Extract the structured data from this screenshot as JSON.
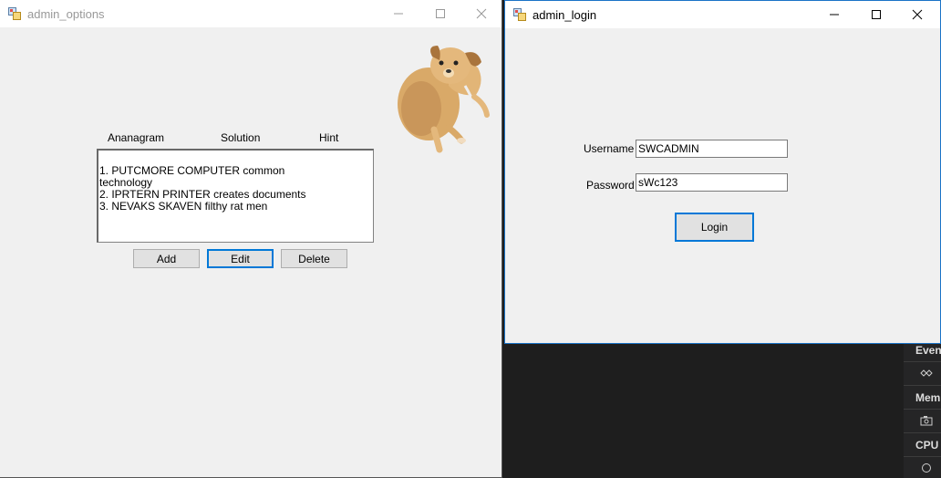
{
  "options_window": {
    "title": "admin_options",
    "headers": {
      "anagram": "Ananagram",
      "solution": "Solution",
      "hint": "Hint"
    },
    "list_lines": [
      "1. PUTCMORE              COMPUTER        common",
      "technology",
      "2. IPRTERN                  PRINTER         creates documents",
      "3. NEVAKS                 SKAVEN         filthy rat men"
    ],
    "buttons": {
      "add": "Add",
      "edit": "Edit",
      "delete": "Delete"
    }
  },
  "login_window": {
    "title": "admin_login",
    "username_label": "Username",
    "username_value": "SWCADMIN",
    "password_label": "Password",
    "password_value": "sWc123",
    "login_button": "Login"
  },
  "side_panel": {
    "items": [
      "Event",
      "Mem",
      "CPU I"
    ]
  },
  "colors": {
    "accent": "#0078d7",
    "window_bg": "#f0f0f0",
    "desktop_bg": "#1e1e1e"
  }
}
